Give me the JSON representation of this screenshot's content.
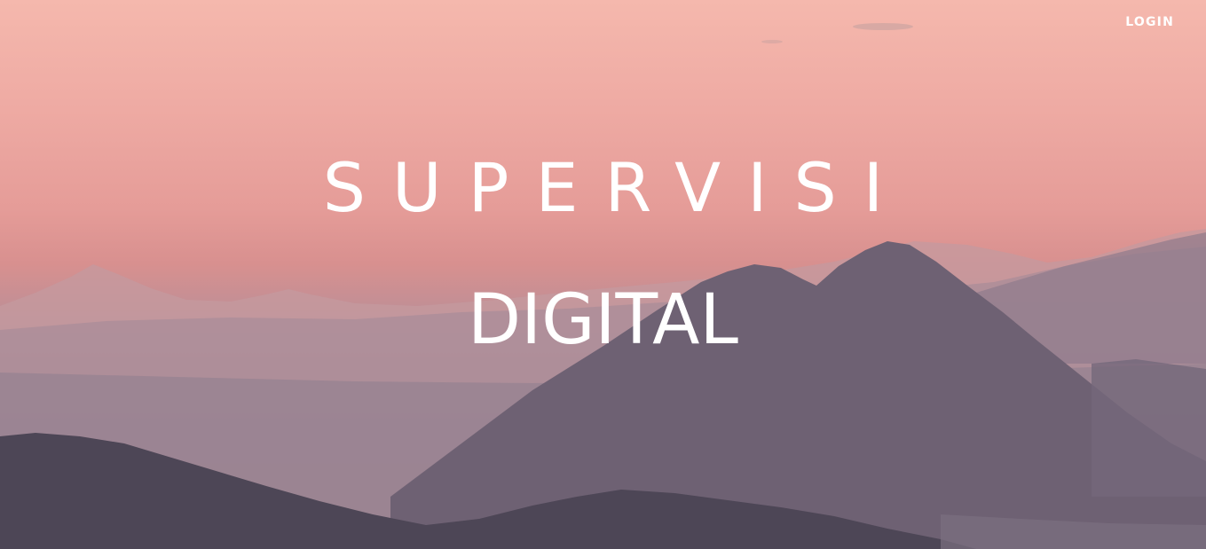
{
  "nav": {
    "login_label": "LOGIN"
  },
  "hero": {
    "title_line_1": "SUPERVISI",
    "title_line_2": "DIGITAL"
  },
  "colors": {
    "sky_top": "#f5b8ad",
    "sky_mid": "#e59c98",
    "far_hills": "#b8949d",
    "mid_hills": "#8f7f8f",
    "main_peak": "#6f6274",
    "foreground_forest": "#4e4757",
    "text": "#ffffff"
  }
}
